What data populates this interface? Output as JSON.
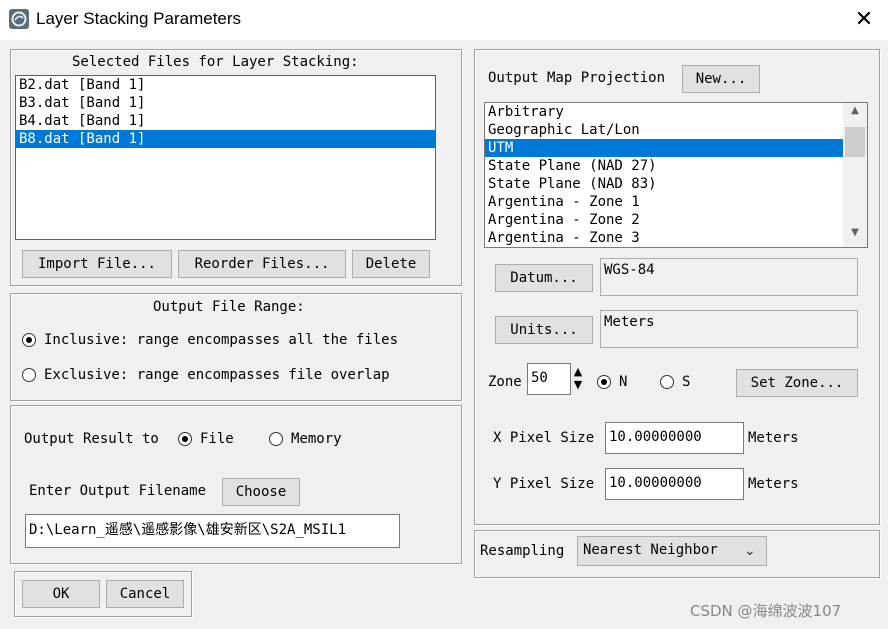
{
  "window": {
    "title": "Layer Stacking Parameters"
  },
  "selected_files": {
    "heading": "Selected Files for Layer Stacking:",
    "items": [
      {
        "label": "B2.dat [Band 1]"
      },
      {
        "label": "B3.dat [Band 1]"
      },
      {
        "label": "B4.dat [Band 1]"
      },
      {
        "label": "B8.dat [Band 1]",
        "selected": true
      }
    ],
    "import_label": "Import File...",
    "reorder_label": "Reorder Files...",
    "delete_label": "Delete"
  },
  "output_range": {
    "heading": "Output File Range:",
    "inclusive_label": "Inclusive: range encompasses all the files",
    "exclusive_label": "Exclusive: range encompasses file overlap",
    "selected": "inclusive"
  },
  "output": {
    "result_to_label": "Output Result to",
    "file_label": "File",
    "memory_label": "Memory",
    "selected": "file",
    "filename_label": "Enter Output Filename",
    "choose_label": "Choose",
    "filename_value": "D:\\Learn_遥感\\遥感影像\\雄安新区\\S2A_MSIL1"
  },
  "dialog_buttons": {
    "ok_label": "OK",
    "cancel_label": "Cancel"
  },
  "projection": {
    "heading": "Output Map Projection",
    "new_label": "New...",
    "items": [
      {
        "label": "Arbitrary"
      },
      {
        "label": "Geographic Lat/Lon"
      },
      {
        "label": "UTM",
        "selected": true
      },
      {
        "label": "State Plane (NAD 27)"
      },
      {
        "label": "State Plane (NAD 83)"
      },
      {
        "label": "Argentina - Zone 1"
      },
      {
        "label": "Argentina - Zone 2"
      },
      {
        "label": "Argentina - Zone 3"
      }
    ],
    "datum_label": "Datum...",
    "datum_value": "WGS-84",
    "units_label": "Units...",
    "units_value": "Meters",
    "zone_label": "Zone",
    "zone_value": "50",
    "north_label": "N",
    "south_label": "S",
    "hemisphere": "N",
    "set_zone_label": "Set Zone...",
    "x_pixel_label": "X Pixel Size",
    "x_pixel_value": "10.00000000",
    "x_pixel_units": "Meters",
    "y_pixel_label": "Y Pixel Size",
    "y_pixel_value": "10.00000000",
    "y_pixel_units": "Meters"
  },
  "resampling": {
    "label": "Resampling",
    "value": "Nearest Neighbor"
  },
  "watermark": "CSDN @海绵波波107"
}
